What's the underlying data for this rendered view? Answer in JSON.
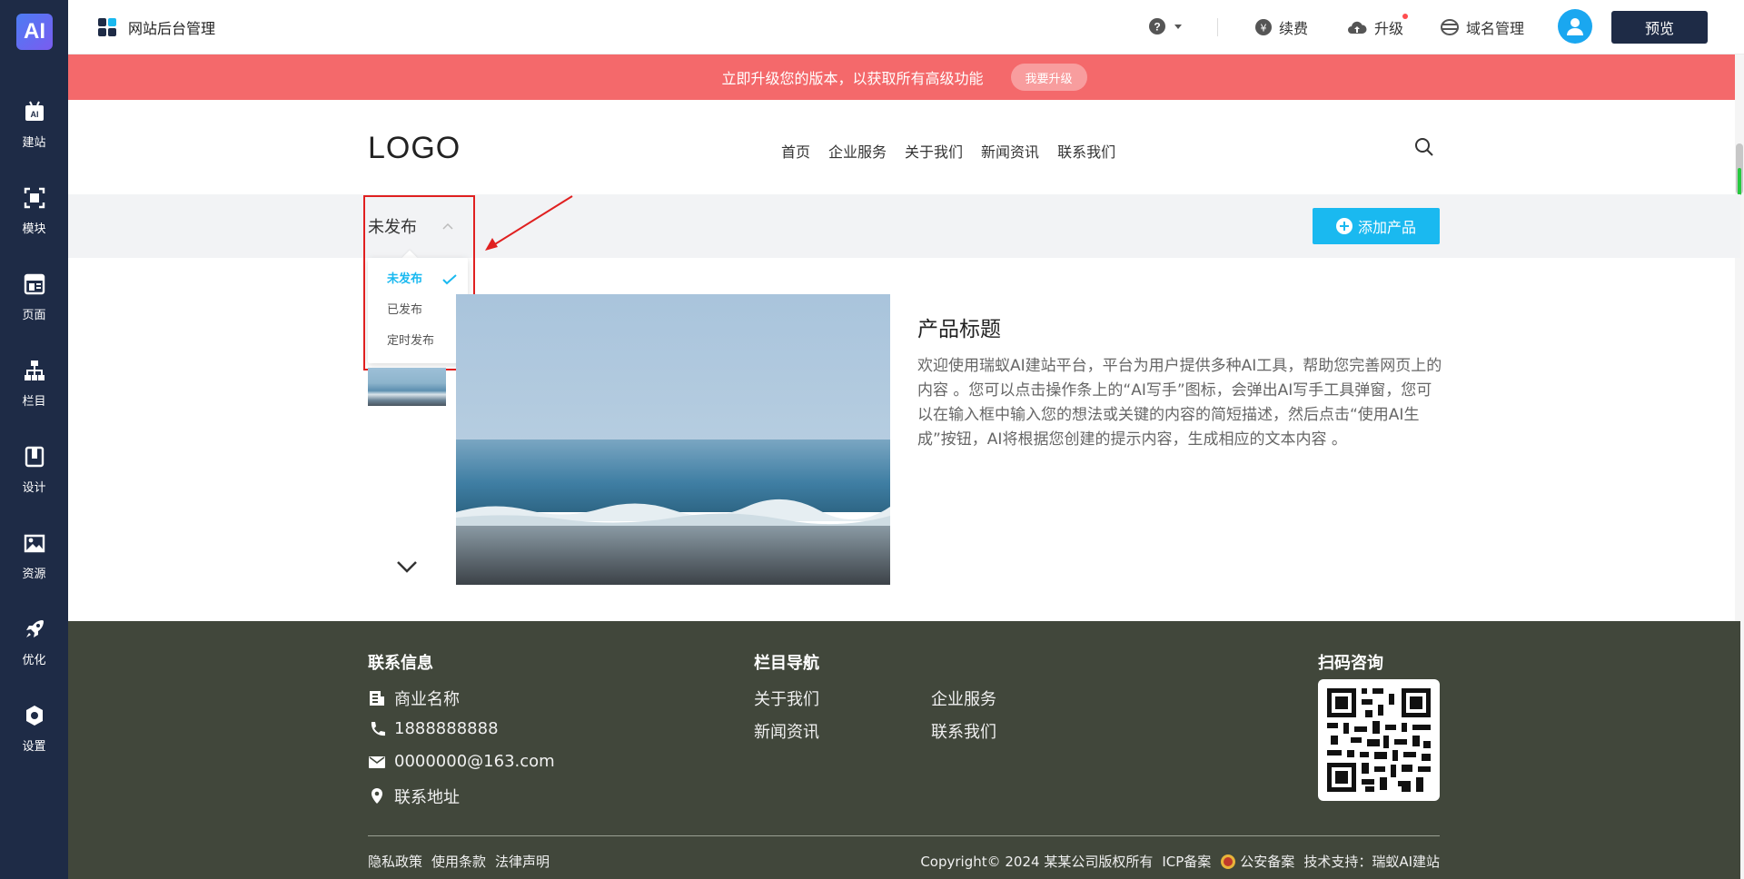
{
  "app": {
    "logo_text": "AI",
    "brand_title": "网站后台管理"
  },
  "sidebar": {
    "items": [
      {
        "label": "建站",
        "icon": "ai-build-icon"
      },
      {
        "label": "模块",
        "icon": "module-icon"
      },
      {
        "label": "页面",
        "icon": "page-icon"
      },
      {
        "label": "栏目",
        "icon": "sitemap-icon"
      },
      {
        "label": "设计",
        "icon": "design-icon"
      },
      {
        "label": "资源",
        "icon": "image-resource-icon"
      },
      {
        "label": "优化",
        "icon": "rocket-icon"
      },
      {
        "label": "设置",
        "icon": "settings-icon"
      }
    ]
  },
  "topbar": {
    "renew": "续费",
    "upgrade": "升级",
    "domain": "域名管理",
    "preview": "预览"
  },
  "banner": {
    "text": "立即升级您的版本，以获取所有高级功能",
    "button": "我要升级"
  },
  "site": {
    "logo": "LOGO",
    "nav": [
      "首页",
      "企业服务",
      "关于我们",
      "新闻资讯",
      "联系我们"
    ]
  },
  "filter": {
    "selected": "未发布",
    "options": [
      "未发布",
      "已发布",
      "定时发布"
    ],
    "add_button": "添加产品"
  },
  "product": {
    "title": "产品标题",
    "description": "欢迎使用瑞蚁AI建站平台，平台为用户提供多种AI工具，帮助您完善网页上的内容 。您可以点击操作条上的“AI写手”图标，会弹出AI写手工具弹窗，您可以在输入框中输入您的想法或关键的内容的简短描述，然后点击“使用AI生成”按钮，AI将根据您创建的提示内容，生成相应的文本内容 。"
  },
  "footer": {
    "contact_heading": "联系信息",
    "company": "商业名称",
    "phone": "1888888888",
    "email": "0000000@163.com",
    "address": "联系地址",
    "nav_heading": "栏目导航",
    "nav": [
      "关于我们",
      "企业服务",
      "新闻资讯",
      "联系我们"
    ],
    "qr_heading": "扫码咨询",
    "legal": [
      "隐私政策",
      "使用条款",
      "法律声明"
    ],
    "copyright": "Copyright© 2024 某某公司版权所有",
    "icp": "ICP备案",
    "police": "公安备案",
    "support": "技术支持：瑞蚁AI建站"
  },
  "colors": {
    "sidebar": "#1e2b46",
    "banner": "#f4696b",
    "accent": "#1ab9f0",
    "footer": "#41473b",
    "highlight": "#e02020"
  }
}
